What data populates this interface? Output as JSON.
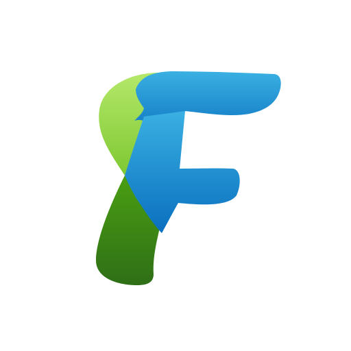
{
  "logo": {
    "letter": "F",
    "icon": "letter-f-logo-icon",
    "colors": {
      "background": "#ffffff",
      "green_light": "#9fdc4f",
      "green_mid": "#4a9e12",
      "green_dark": "#2f6f17",
      "blue_light": "#3ab0e2",
      "blue_mid": "#1a8fd6",
      "blue_dark": "#0a6fbf"
    }
  }
}
